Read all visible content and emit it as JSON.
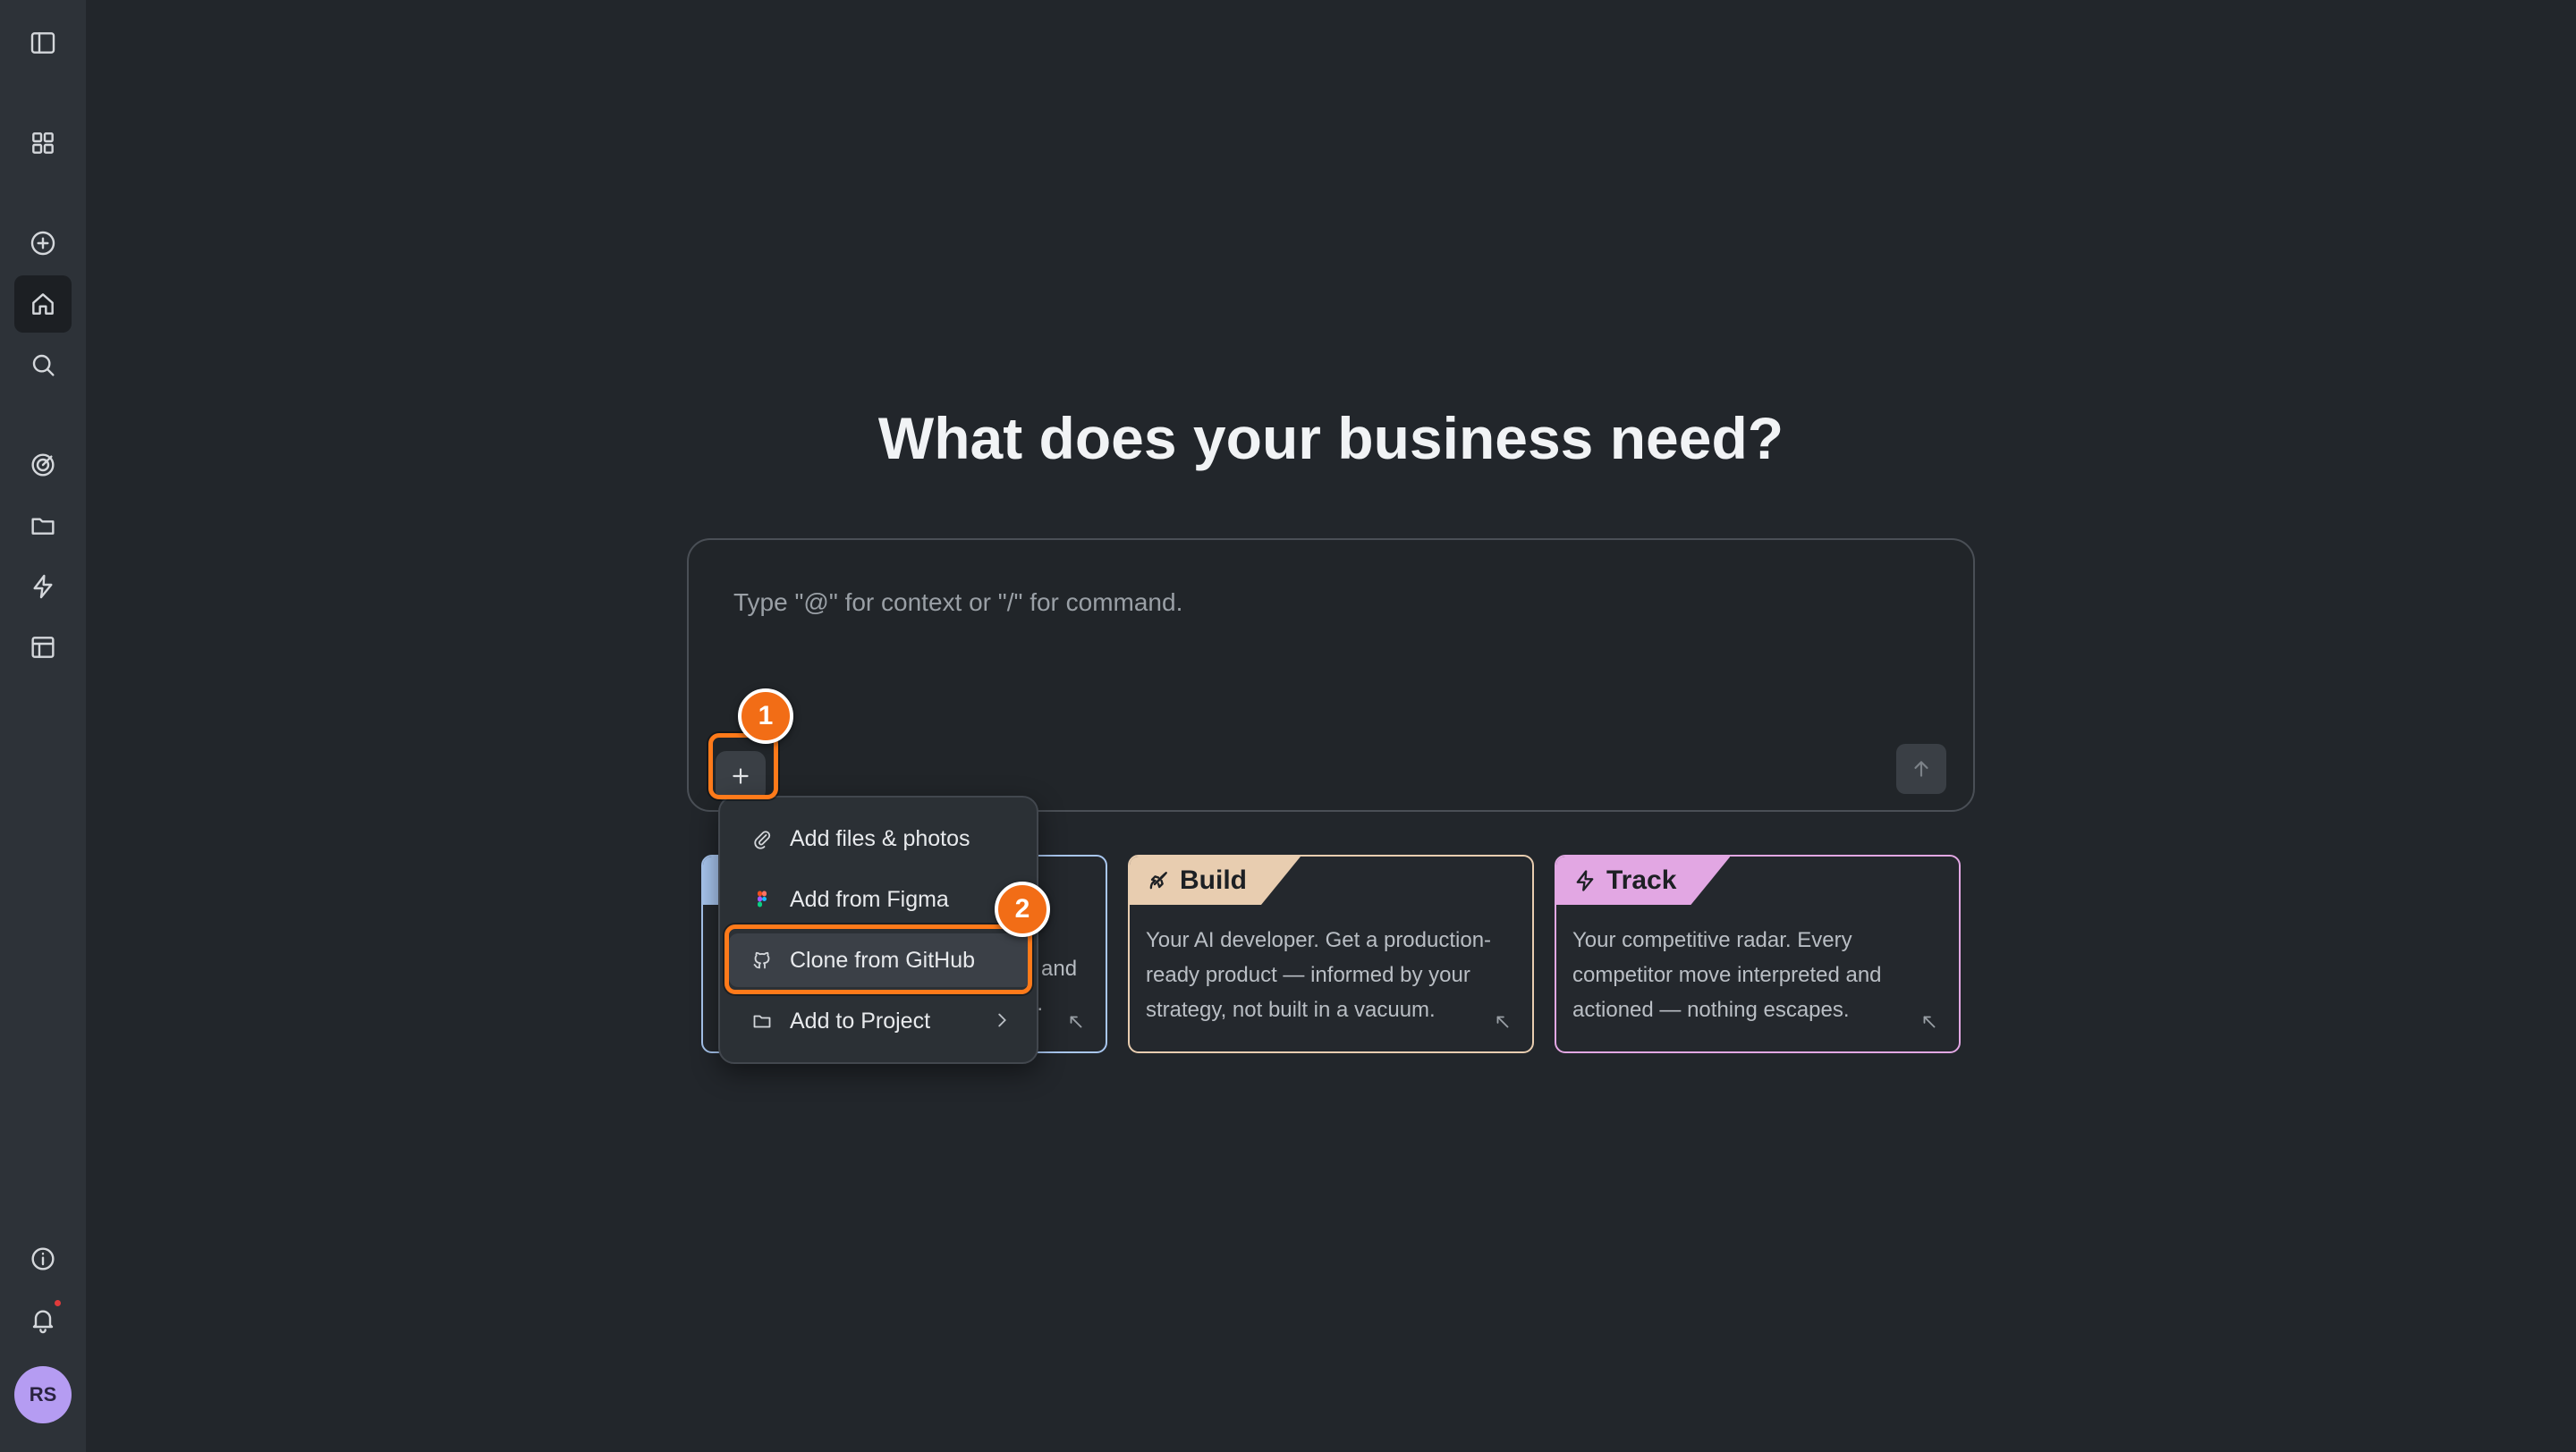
{
  "sidebar": {
    "items": [
      {
        "icon": "sidebar-toggle-icon"
      },
      {
        "icon": "grid-icon"
      },
      {
        "icon": "plus-circle-icon"
      },
      {
        "icon": "home-icon",
        "active": true
      },
      {
        "icon": "search-icon"
      },
      {
        "icon": "target-icon"
      },
      {
        "icon": "folder-icon"
      },
      {
        "icon": "lightning-icon"
      },
      {
        "icon": "layout-icon"
      },
      {
        "icon": "info-icon"
      },
      {
        "icon": "bell-icon"
      }
    ],
    "avatar_initials": "RS"
  },
  "main": {
    "heading": "What does your business need?",
    "composer": {
      "placeholder": "Type \"@\" for context or \"/\" for command.",
      "value": ""
    }
  },
  "cards": [
    {
      "tag": "Build",
      "description": "Your AI developer. Get a production-ready product — informed by your strategy, not built in a vacuum.",
      "accent": "#e8cdb0"
    },
    {
      "tag": "Track",
      "description": "Your competitive radar. Every competitor move interpreted and actioned — nothing escapes.",
      "accent": "#e2a7e3"
    }
  ],
  "hidden_card": {
    "accent": "#a9c7f0",
    "visible_fragments": [
      "and",
      "d."
    ]
  },
  "menu": {
    "items": [
      {
        "label": "Add files & photos",
        "icon": "paperclip-icon"
      },
      {
        "label": "Add from Figma",
        "icon": "figma-icon"
      },
      {
        "label": "Clone from GitHub",
        "icon": "github-icon"
      },
      {
        "label": "Add to Project",
        "icon": "folder-icon",
        "has_submenu": true
      }
    ]
  },
  "annotations": {
    "step_1": "1",
    "step_2": "2",
    "highlight_color": "#ff7a1a"
  }
}
